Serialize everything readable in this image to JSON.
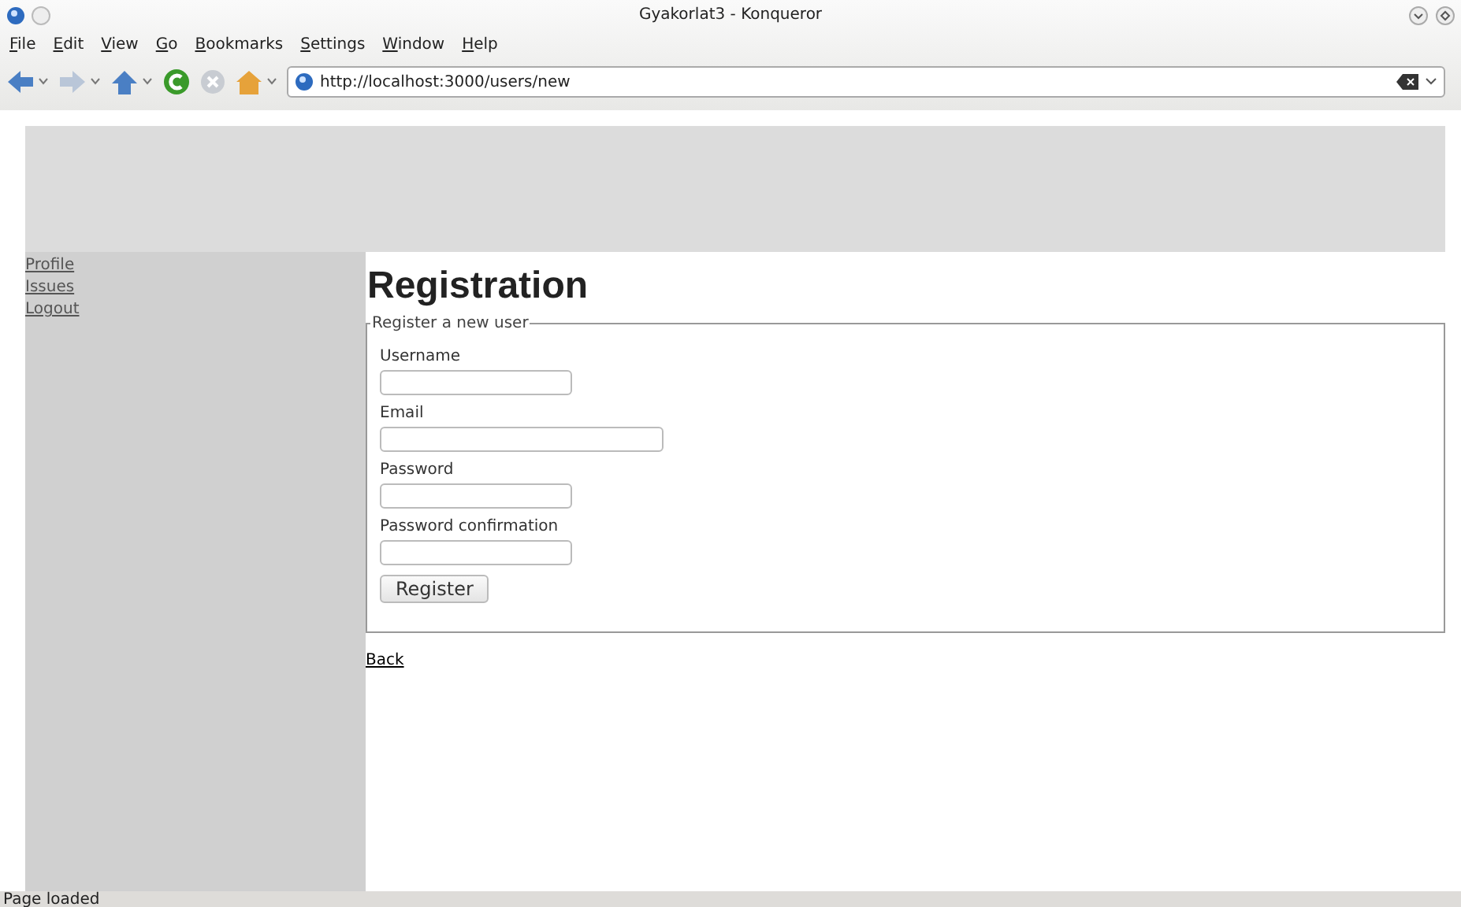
{
  "window": {
    "title": "Gyakorlat3 - Konqueror"
  },
  "menu": [
    "File",
    "Edit",
    "View",
    "Go",
    "Bookmarks",
    "Settings",
    "Window",
    "Help"
  ],
  "toolbar": {
    "url": "http://localhost:3000/users/new"
  },
  "sidebar": {
    "items": [
      "Profile",
      "Issues",
      "Logout"
    ]
  },
  "content": {
    "heading": "Registration",
    "legend": "Register a new user",
    "fields": [
      {
        "label": "Username",
        "kind": "text"
      },
      {
        "label": "Email",
        "kind": "email"
      },
      {
        "label": "Password",
        "kind": "password"
      },
      {
        "label": "Password confirmation",
        "kind": "password"
      }
    ],
    "button": "Register",
    "back_link": "Back"
  },
  "status_bar": "Page loaded"
}
